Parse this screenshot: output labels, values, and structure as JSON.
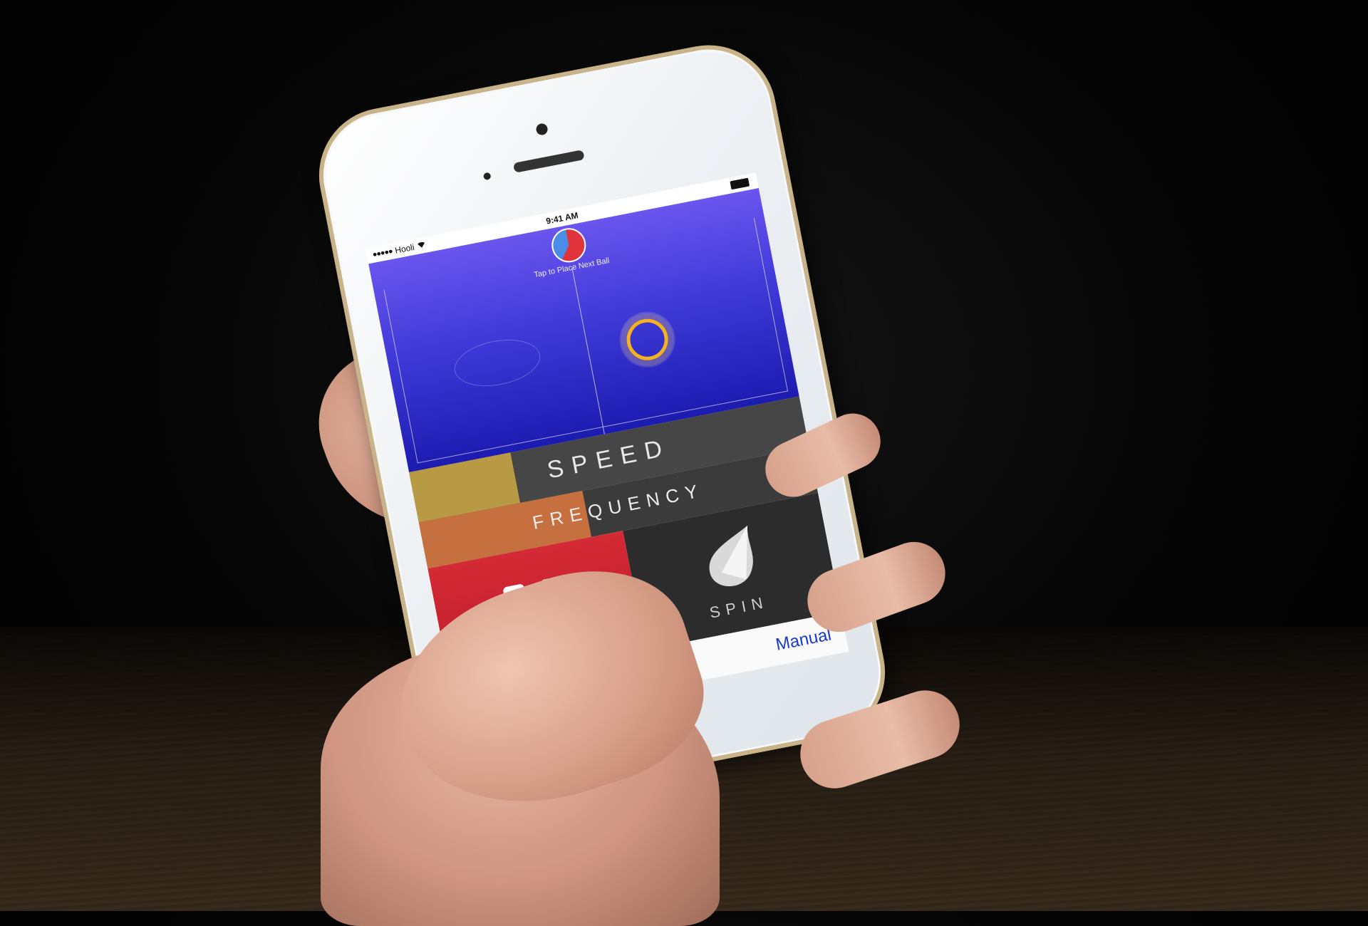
{
  "status_bar": {
    "signal": "●●●●●",
    "carrier": "Hooli",
    "wifi": "wifi-icon",
    "time": "9:41 AM"
  },
  "court": {
    "hint": "Tap to Place Next Ball",
    "timer_fraction": 0.6
  },
  "controls": {
    "speed_label": "SPEED",
    "speed_level": 0.26,
    "frequency_label": "FREQUENCY",
    "frequency_level": 0.42,
    "play_state_icon": "pause-icon",
    "spin_label": "SPIN",
    "spin_icon": "spin-icon",
    "mode_label": "Manual"
  },
  "colors": {
    "court_top": "#6a55ee",
    "court_bottom": "#1c1bb0",
    "speed_fill": "#b99a44",
    "frequency_fill": "#c7703f",
    "play_button": "#d42a35",
    "target_ring": "#f4b31c",
    "mode_text": "#1a39c8"
  }
}
